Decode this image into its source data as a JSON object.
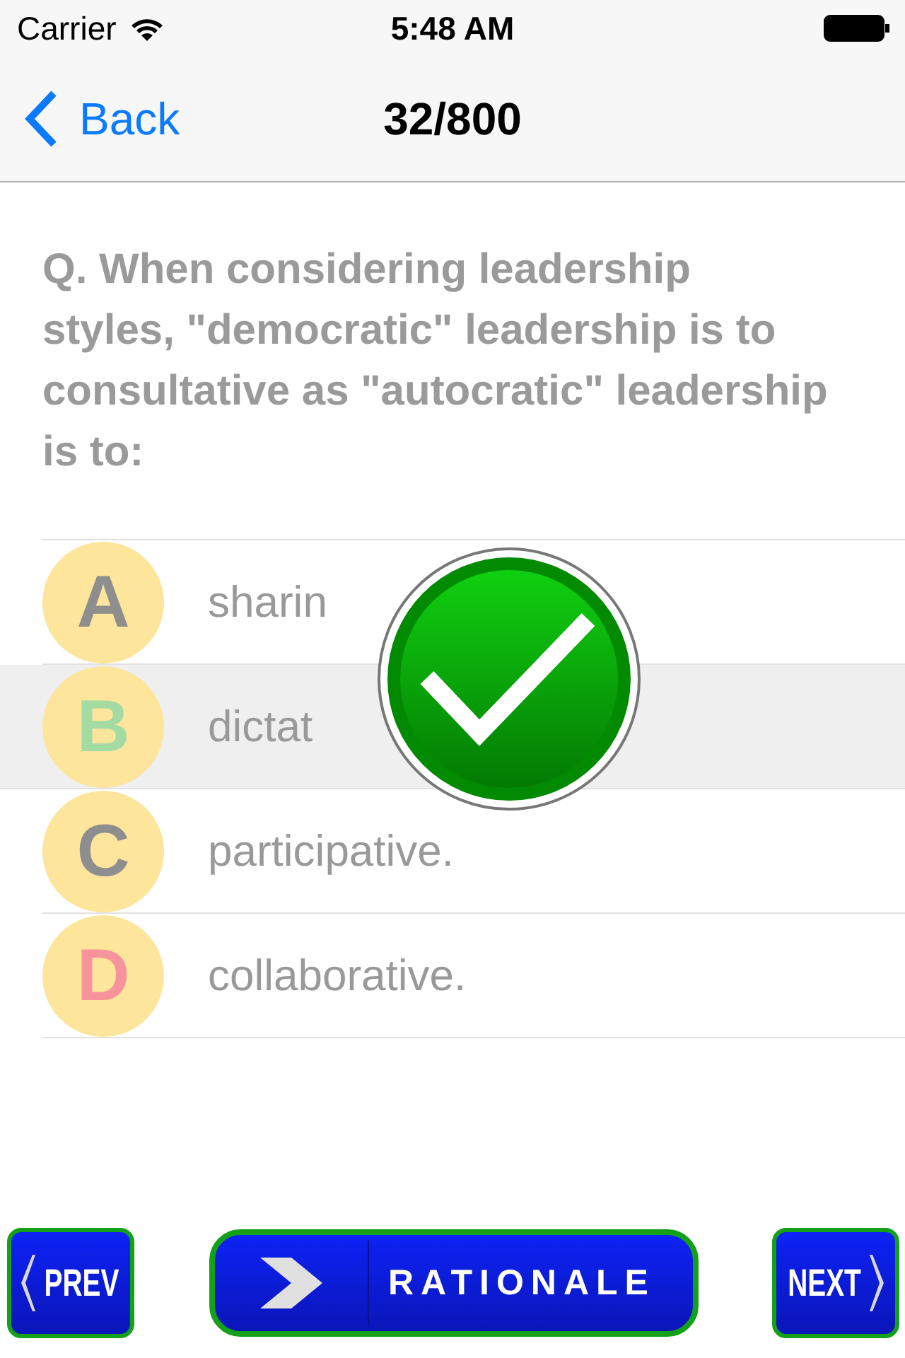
{
  "status_bar": {
    "carrier": "Carrier",
    "time": "5:48 AM"
  },
  "nav": {
    "back": "Back",
    "title": "32/800"
  },
  "question": "Q. When considering leadership styles, \"democratic\" leadership is to consultative as \"autocratic\" leadership is to:",
  "answers": [
    {
      "letter": "A",
      "text": "sharin",
      "color": "#8e8e8e",
      "selected": false
    },
    {
      "letter": "B",
      "text": "dictat",
      "color": "#a3dba3",
      "selected": true
    },
    {
      "letter": "C",
      "text": "participative.",
      "color": "#8e8e8e",
      "selected": false
    },
    {
      "letter": "D",
      "text": "collaborative.",
      "color": "#f7939b",
      "selected": false
    }
  ],
  "result": {
    "kind": "correct"
  },
  "buttons": {
    "prev": "PREV",
    "rationale": "RATIONALE",
    "next": "NEXT"
  }
}
